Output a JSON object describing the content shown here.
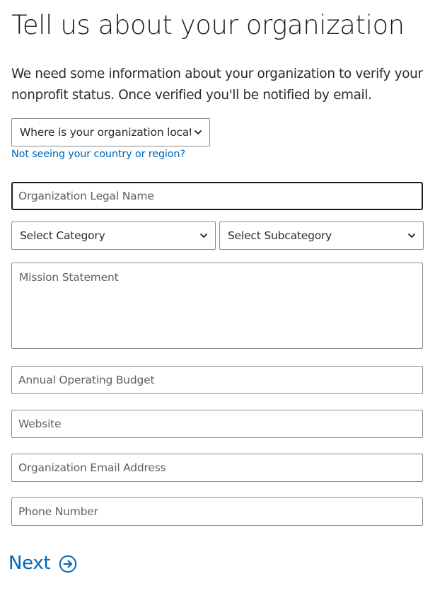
{
  "page": {
    "title": "Tell us about your organization",
    "intro": "We need some information about your organization to verify your nonprofit status. Once verified you'll be notified by email."
  },
  "form": {
    "country_select": {
      "selected": "Where is your organization located?"
    },
    "region_link": "Not seeing your country or region?",
    "legal_name": {
      "placeholder": "Organization Legal Name",
      "value": ""
    },
    "category_select": {
      "selected": "Select Category"
    },
    "subcategory_select": {
      "selected": "Select Subcategory"
    },
    "mission_statement": {
      "placeholder": "Mission Statement",
      "value": ""
    },
    "annual_budget": {
      "placeholder": "Annual Operating Budget",
      "value": ""
    },
    "website": {
      "placeholder": "Website",
      "value": ""
    },
    "email": {
      "placeholder": "Organization Email Address",
      "value": ""
    },
    "phone": {
      "placeholder": "Phone Number",
      "value": ""
    }
  },
  "actions": {
    "next_label": "Next",
    "next_icon": "arrow-right-circle-icon"
  },
  "colors": {
    "accent": "#0067b8",
    "border": "#8a8a8a",
    "focus_border": "#1b1b1b",
    "text": "#1b1b1b"
  }
}
